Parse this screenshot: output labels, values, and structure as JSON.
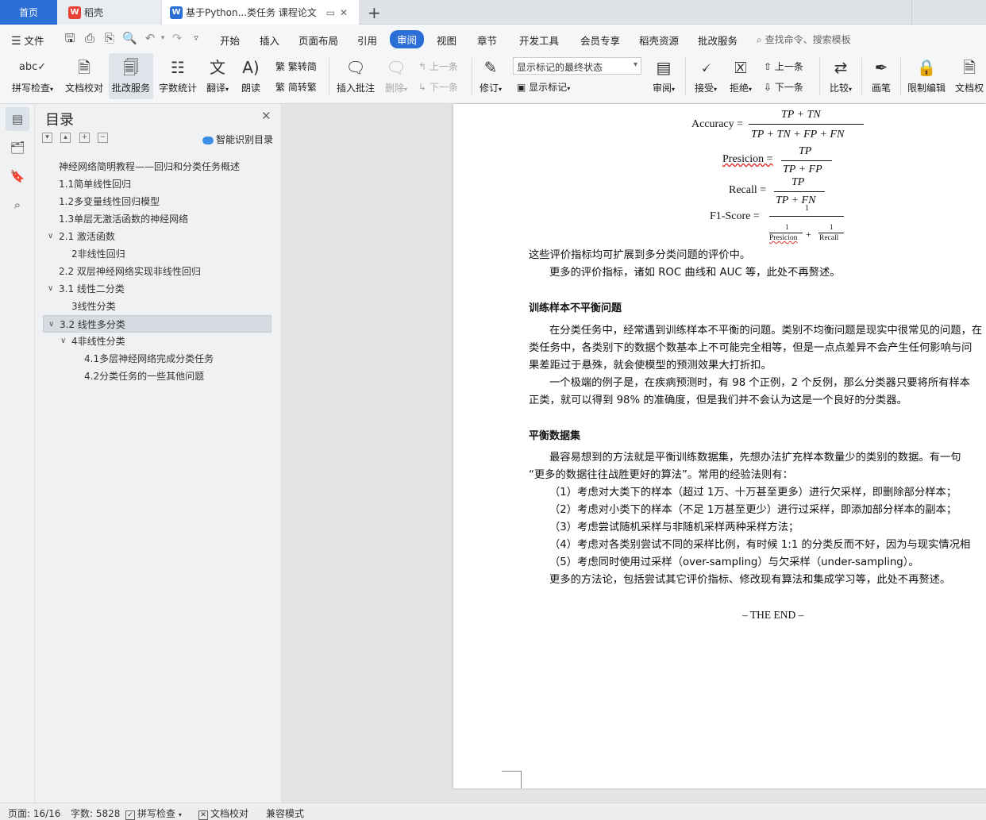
{
  "tabs": {
    "home": "首页",
    "daoke": "稻壳",
    "doc": "基于Python...类任务 课程论文"
  },
  "menu": {
    "file": "文件",
    "items": [
      "开始",
      "插入",
      "页面布局",
      "引用",
      "审阅",
      "视图",
      "章节",
      "开发工具",
      "会员专享",
      "稻壳资源",
      "批改服务"
    ],
    "active": "审阅",
    "search": "查找命令、搜索模板"
  },
  "ribbon": {
    "spell_check": "拼写检查",
    "doc_proof": "文档校对",
    "review_service": "批改服务",
    "word_count": "字数统计",
    "translate": "翻译",
    "read_aloud": "朗读",
    "trad_to_simp": "繁转简",
    "simp_to_trad": "简转繁",
    "insert_comment": "插入批注",
    "delete": "删除",
    "prev_comment": "上一条",
    "next_comment": "下一条",
    "revise": "修订",
    "markup_state": "显示标记的最终状态",
    "show_markup": "显示标记",
    "review": "审阅",
    "accept": "接受",
    "reject": "拒绝",
    "prev_change": "上一条",
    "next_change": "下一条",
    "compare": "比较",
    "pen": "画笔",
    "restrict_edit": "限制编辑",
    "doc_permission": "文档权"
  },
  "toc": {
    "title": "目录",
    "smart": "智能识别目录",
    "items": [
      {
        "label": "神经网络简明教程——回归和分类任务概述",
        "level": 0
      },
      {
        "label": "1.1简单线性回归",
        "level": 0
      },
      {
        "label": "1.2多变量线性回归模型",
        "level": 0
      },
      {
        "label": "1.3单层无激活函数的神经网络",
        "level": 0
      },
      {
        "label": "2.1 激活函数",
        "level": 0
      },
      {
        "label": "2非线性回归",
        "level": 1
      },
      {
        "label": "2.2 双层神经网络实现非线性回归",
        "level": 0
      },
      {
        "label": "3.1 线性二分类",
        "level": 0
      },
      {
        "label": "3线性分类",
        "level": 1
      },
      {
        "label": "3.2 线性多分类",
        "level": 0
      },
      {
        "label": "4非线性分类",
        "level": 1
      },
      {
        "label": "4.1多层神经网络完成分类任务",
        "level": 2
      },
      {
        "label": "4.2分类任务的一些其他问题",
        "level": 2
      }
    ]
  },
  "document": {
    "formulas": {
      "accuracy_lhs": "Accuracy =",
      "accuracy_num": "TP + TN",
      "accuracy_den": "TP + TN + FP + FN",
      "precision_lhs": "Presicion =",
      "precision_num": "TP",
      "precision_den": "TP + FP",
      "recall_lhs": "Recall =",
      "recall_num": "TP",
      "recall_den": "TP + FN",
      "f1_lhs": "F1-Score =",
      "f1_num": "1",
      "f1_one_a": "1",
      "f1_den_a": "Presicion",
      "f1_plus": "+",
      "f1_one_b": "1",
      "f1_den_b": "Recall"
    },
    "p1": "这些评价指标均可扩展到多分类问题的评价中。",
    "p2": "更多的评价指标，诸如 ROC 曲线和 AUC 等，此处不再赘述。",
    "h1": "训练样本不平衡问题",
    "p3a": "在分类任务中，经常遇到训练样本不平衡的问题。类别不均衡问题是现实中很常见的问题，在",
    "p3b": "类任务中，各类别下的数据个数基本上不可能完全相等，但是一点点差异不会产生任何影响与问",
    "p3c": "果差距过于悬殊，就会使模型的预测效果大打折扣。",
    "p4a": "一个极端的例子是，在疾病预测时，有 98 个正例，2 个反例，那么分类器只要将所有样本",
    "p4b": "正类，就可以得到 98% 的准确度，但是我们并不会认为这是一个良好的分类器。",
    "h2": "平衡数据集",
    "p5a": "最容易想到的方法就是平衡训练数据集，先想办法扩充样本数量少的类别的数据。有一句",
    "p5b": "“更多的数据往往战胜更好的算法”。常用的经验法则有：",
    "l1": "（1）考虑对大类下的样本（超过 1万、十万甚至更多）进行欠采样，即删除部分样本；",
    "l2": "（2）考虑对小类下的样本（不足 1万甚至更少）进行过采样，即添加部分样本的副本；",
    "l3": "（3）考虑尝试随机采样与非随机采样两种采样方法；",
    "l4": "（4）考虑对各类别尝试不同的采样比例，有时候 1:1 的分类反而不好，因为与现实情况相",
    "l5": "（5）考虑同时使用过采样（over-sampling）与欠采样（under-sampling）。",
    "p6": "更多的方法论，包括尝试其它评价指标、修改现有算法和集成学习等，此处不再赘述。",
    "end": "– THE END –"
  },
  "status": {
    "page": "页面: 16/16",
    "words": "字数: 5828",
    "spell": "拼写检查",
    "proof": "文档校对",
    "compat": "兼容模式"
  },
  "colors": {
    "accent": "#2b6fd6"
  }
}
